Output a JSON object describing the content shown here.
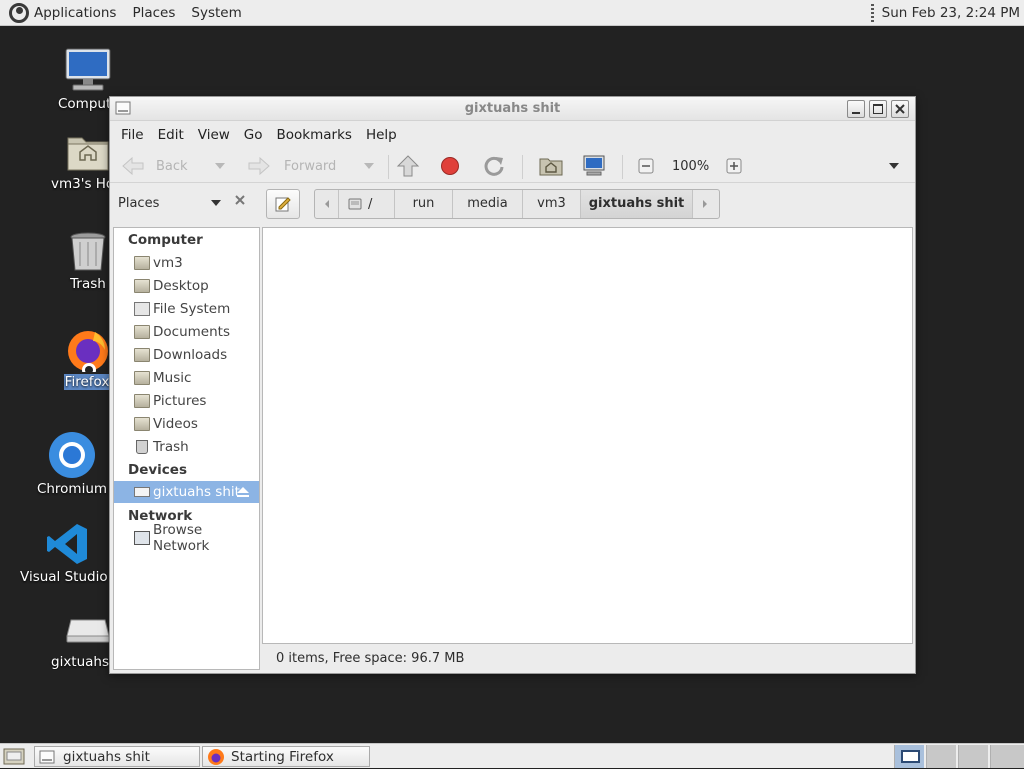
{
  "top_panel": {
    "menus": [
      "Applications",
      "Places",
      "System"
    ],
    "clock": "Sun Feb 23,  2:24 PM"
  },
  "desktop_icons": [
    {
      "label": "Comput",
      "icon": "computer-icon"
    },
    {
      "label": "vm3's Ho",
      "icon": "home-folder-icon"
    },
    {
      "label": "Trash",
      "icon": "trash-icon"
    },
    {
      "label": "Firefox",
      "icon": "firefox-icon"
    },
    {
      "label": "Chromium",
      "icon": "chromium-icon"
    },
    {
      "label": "Visual Studio C",
      "icon": "vscode-icon"
    },
    {
      "label": "gixtuahs s",
      "icon": "drive-icon"
    }
  ],
  "window": {
    "title": "gixtuahs shit",
    "menu": [
      "File",
      "Edit",
      "View",
      "Go",
      "Bookmarks",
      "Help"
    ],
    "toolbar": {
      "back": "Back",
      "forward": "Forward",
      "zoom": "100%"
    },
    "sidebar_selector": "Places",
    "path": [
      "/",
      "run",
      "media",
      "vm3",
      "gixtuahs shit"
    ],
    "sidebar": {
      "computer_heading": "Computer",
      "computer_items": [
        "vm3",
        "Desktop",
        "File System",
        "Documents",
        "Downloads",
        "Music",
        "Pictures",
        "Videos",
        "Trash"
      ],
      "devices_heading": "Devices",
      "devices_items": [
        "gixtuahs shit"
      ],
      "network_heading": "Network",
      "network_items": [
        "Browse Network"
      ]
    },
    "status": "0 items, Free space: 96.7 MB"
  },
  "taskbar": {
    "tasks": [
      "gixtuahs shit",
      "Starting Firefox"
    ]
  },
  "colors": {
    "desktop": "#222222",
    "panel": "#ededed",
    "selection": "#8cb4e4"
  }
}
